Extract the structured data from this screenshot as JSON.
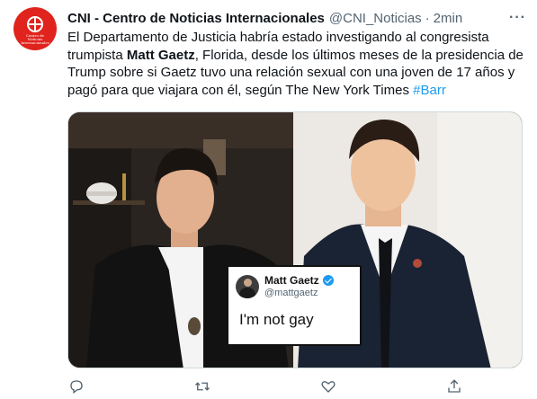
{
  "tweet": {
    "display_name": "CNI - Centro de Noticias Internacionales",
    "handle": "@CNI_Noticias",
    "separator": "·",
    "time": "2min",
    "more": "···",
    "text_part1": "El Departamento de Justicia habría estado investigando al congresista trumpista ",
    "text_bold": "Matt Gaetz",
    "text_part2": ", Florida, desde los últimos meses de la presidencia de Trump sobre si Gaetz tuvo una relación sexual con una joven de 17 años y pagó para que viajara con él, según The New York Times ",
    "hashtag": "#Barr",
    "avatar_text": "Centro de Noticias Internacionales"
  },
  "quote_card": {
    "name": "Matt Gaetz",
    "handle": "@mattgaetz",
    "text": "I'm not gay"
  },
  "actions": {
    "reply": "reply-icon",
    "retweet": "retweet-icon",
    "like": "like-icon",
    "share": "share-icon"
  },
  "colors": {
    "brand_red": "#e0231d",
    "link_blue": "#1d9bf0",
    "text": "#0f1419",
    "muted": "#536471"
  }
}
